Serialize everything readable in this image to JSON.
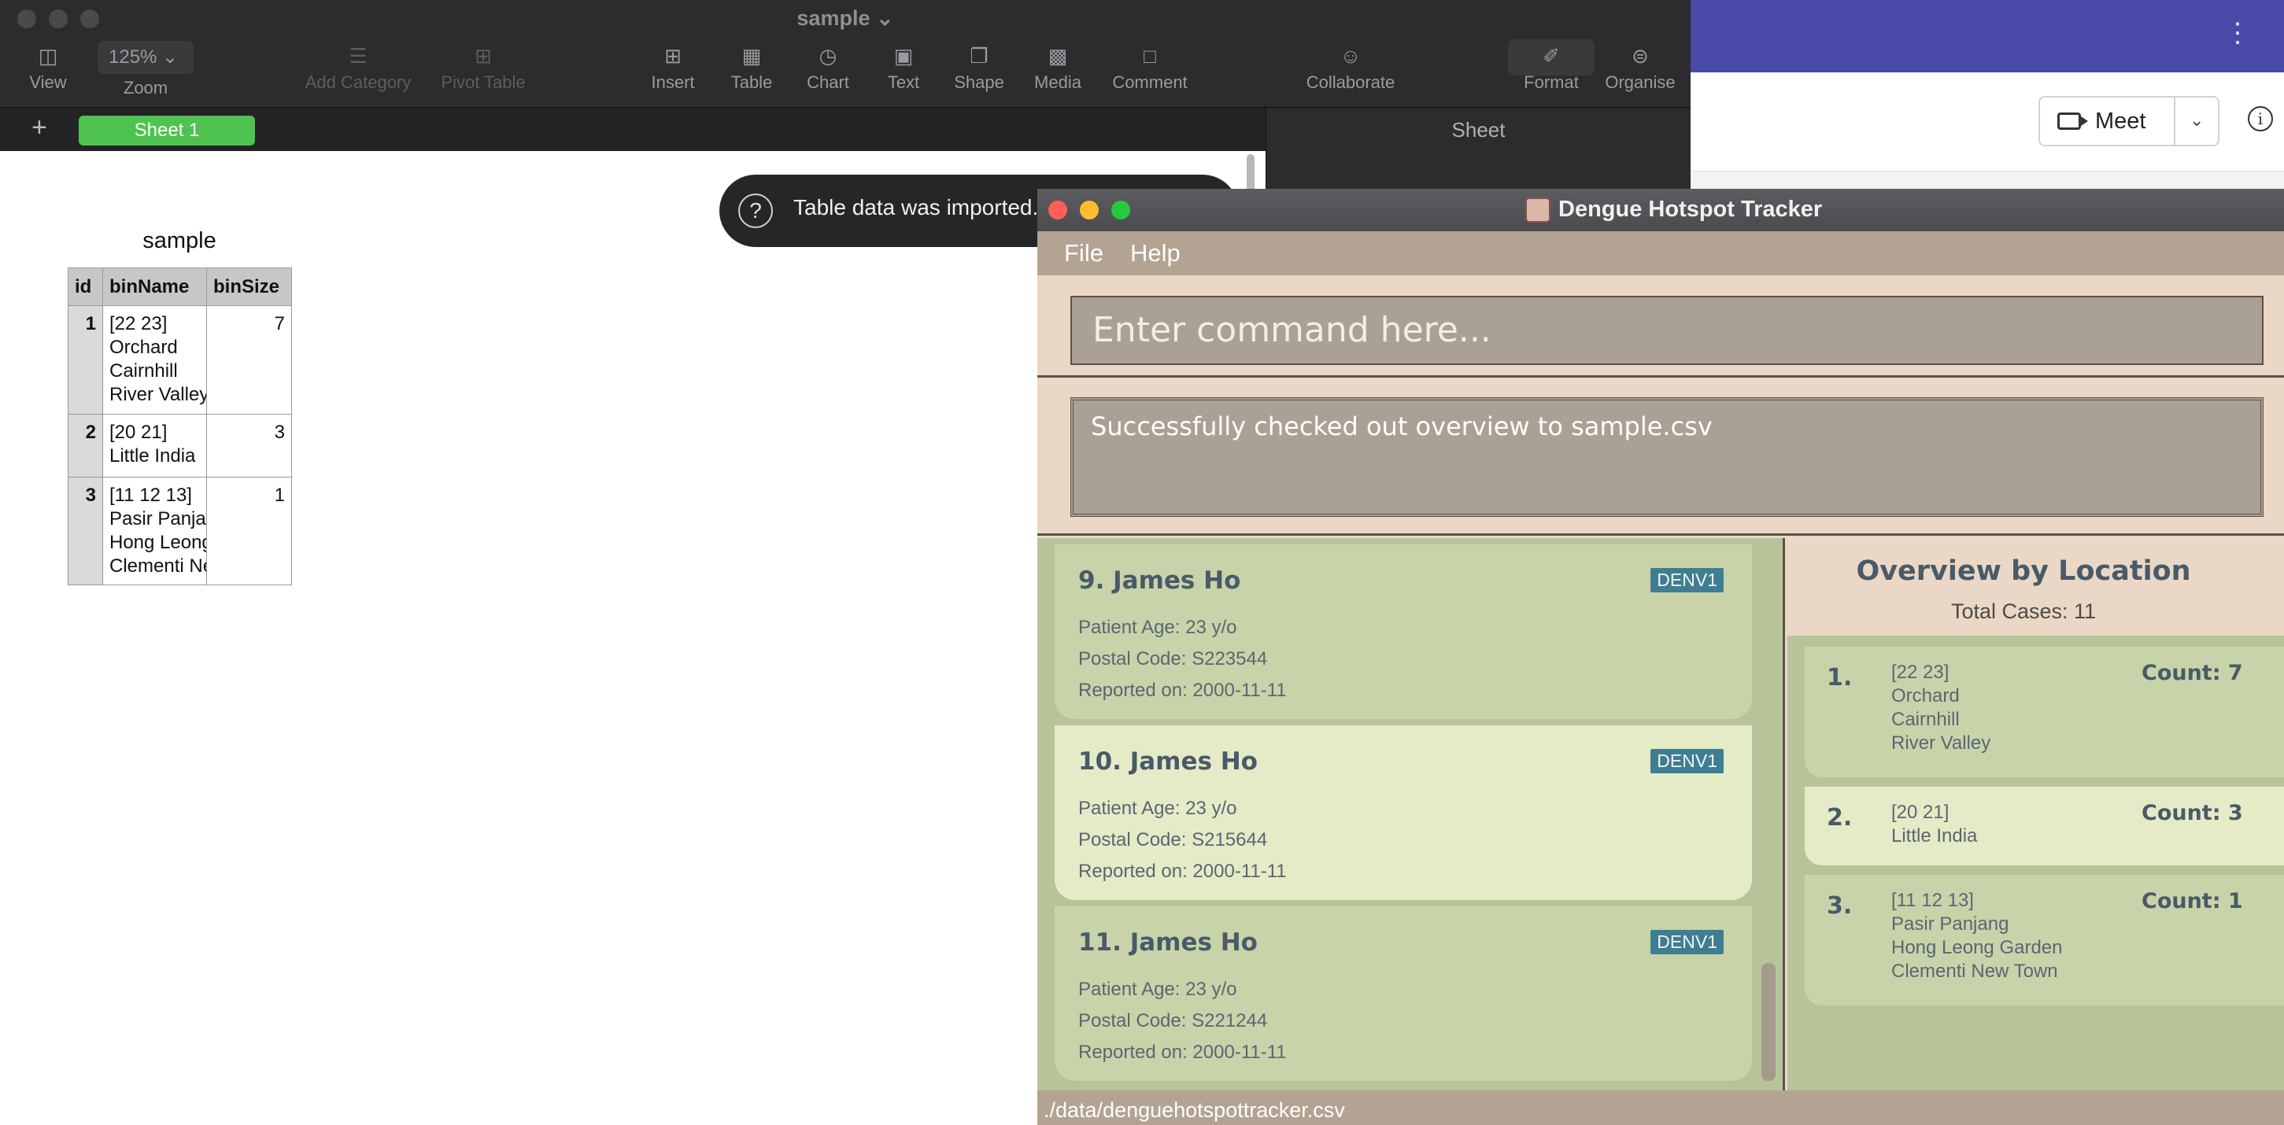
{
  "numbers": {
    "window_title": "sample",
    "toolbar": {
      "view": "View",
      "zoom_value": "125%",
      "zoom": "Zoom",
      "add_category": "Add Category",
      "pivot_table": "Pivot Table",
      "insert": "Insert",
      "table": "Table",
      "chart": "Chart",
      "text": "Text",
      "shape": "Shape",
      "media": "Media",
      "comment": "Comment",
      "collaborate": "Collaborate",
      "format": "Format",
      "organise": "Organise"
    },
    "sheet_tab": "Sheet 1",
    "sidebar_header": "Sheet",
    "sheet_title": "sample",
    "table": {
      "headers": [
        "id",
        "binName",
        "binSize"
      ],
      "rows": [
        {
          "id": "1",
          "name": [
            "[22 23]",
            "Orchard",
            "Cairnhill",
            "River Valley"
          ],
          "size": "7"
        },
        {
          "id": "2",
          "name": [
            "[20 21]",
            "Little India"
          ],
          "size": "3"
        },
        {
          "id": "3",
          "name": [
            "[11 12 13]",
            "Pasir Panjang",
            "Hong Leong Garden",
            "Clementi New Town"
          ],
          "size": "1"
        }
      ]
    },
    "toast": "Table data was imported."
  },
  "background": {
    "meet_label": "Meet",
    "dots": "⋮"
  },
  "app": {
    "title": "Dengue Hotspot Tracker",
    "menu": {
      "file": "File",
      "help": "Help"
    },
    "command_placeholder": "Enter command here...",
    "result": "Successfully checked out overview to sample.csv",
    "cases": [
      {
        "name": "9. James Ho",
        "badge": "DENV1",
        "age": "Patient Age: 23 y/o",
        "postal": "Postal Code: S223544",
        "date": "Reported on: 2000-11-11"
      },
      {
        "name": "10. James Ho",
        "badge": "DENV1",
        "age": "Patient Age: 23 y/o",
        "postal": "Postal Code: S215644",
        "date": "Reported on: 2000-11-11"
      },
      {
        "name": "11. James Ho",
        "badge": "DENV1",
        "age": "Patient Age: 23 y/o",
        "postal": "Postal Code: S221244",
        "date": "Reported on: 2000-11-11"
      }
    ],
    "overview": {
      "title": "Overview by Location",
      "total": "Total Cases: 11",
      "items": [
        {
          "index": "1.",
          "lines": [
            "[22 23]",
            "Orchard",
            "Cairnhill",
            "River Valley"
          ],
          "count": "Count: 7"
        },
        {
          "index": "2.",
          "lines": [
            "[20 21]",
            "Little India"
          ],
          "count": "Count: 3"
        },
        {
          "index": "3.",
          "lines": [
            "[11 12 13]",
            "Pasir Panjang",
            "Hong Leong Garden",
            "Clementi New Town"
          ],
          "count": "Count: 1"
        }
      ]
    },
    "status_path": "./data/denguehotspottracker.csv"
  },
  "colors": {
    "sheet_tab": "#4fc34f",
    "badge": "#3f7e92",
    "card_dark": "#c8d3a9",
    "card_light": "#e4ebc6",
    "app_bg": "#ebd7c5",
    "menubar": "#b2a392",
    "close": "#ff5f57",
    "minimize": "#febc2e",
    "zoom": "#28c840"
  }
}
